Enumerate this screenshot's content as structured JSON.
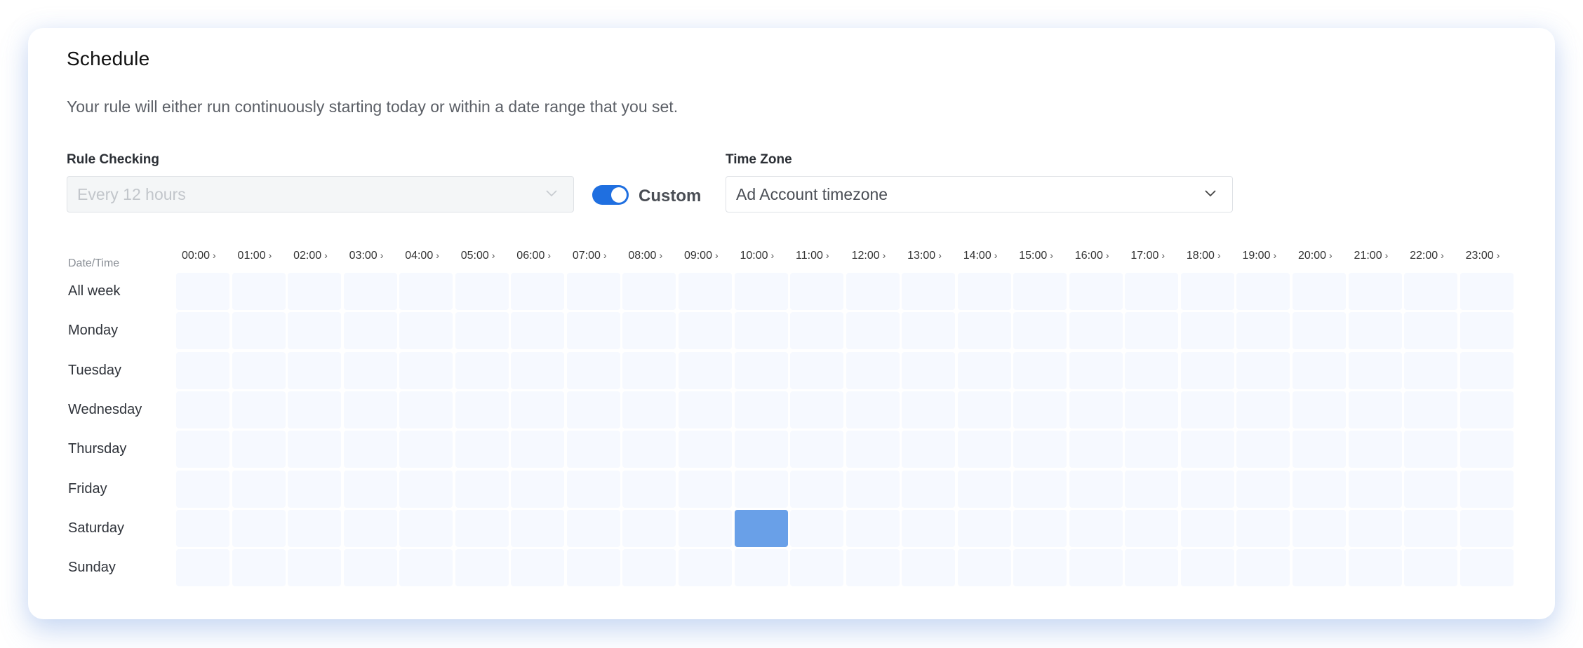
{
  "section": {
    "title": "Schedule",
    "description": "Your rule will either run continuously starting today or within a date range that you set."
  },
  "rule_checking": {
    "label": "Rule Checking",
    "value": "Every 12 hours",
    "disabled": true
  },
  "custom_toggle": {
    "label": "Custom",
    "on": true
  },
  "time_zone": {
    "label": "Time Zone",
    "value": "Ad Account timezone"
  },
  "grid": {
    "corner_label": "Date/Time",
    "hours": [
      "00:00",
      "01:00",
      "02:00",
      "03:00",
      "04:00",
      "05:00",
      "06:00",
      "07:00",
      "08:00",
      "09:00",
      "10:00",
      "11:00",
      "12:00",
      "13:00",
      "14:00",
      "15:00",
      "16:00",
      "17:00",
      "18:00",
      "19:00",
      "20:00",
      "21:00",
      "22:00",
      "23:00"
    ],
    "days": [
      "All week",
      "Monday",
      "Tuesday",
      "Wednesday",
      "Thursday",
      "Friday",
      "Saturday",
      "Sunday"
    ],
    "selected": [
      {
        "day": "Saturday",
        "hour": "10:00"
      }
    ],
    "colors": {
      "empty": "#f6f9ff",
      "selected": "#69a0e8"
    }
  },
  "icons": {
    "chevron_down": "chevron-down-icon",
    "chevron_right": "chevron-right-icon"
  }
}
